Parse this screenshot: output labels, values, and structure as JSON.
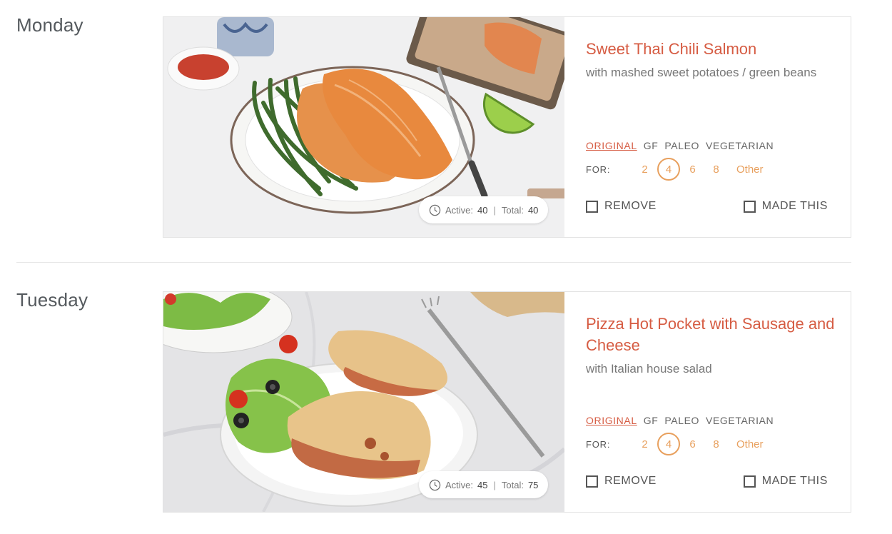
{
  "days": [
    {
      "day": "Monday",
      "recipe": {
        "title": "Sweet Thai Chili Salmon",
        "subtitle": "with mashed sweet potatoes / green beans",
        "tags": [
          "ORIGINAL",
          "GF",
          "PALEO",
          "VEGETARIAN"
        ],
        "for_label": "FOR:",
        "servings": [
          "2",
          "4",
          "6",
          "8"
        ],
        "servings_other": "Other",
        "selected_serving": "4",
        "time": {
          "active_label": "Active:",
          "active": "40",
          "total_label": "Total:",
          "total": "40"
        },
        "remove_label": "REMOVE",
        "made_label": "MADE THIS"
      }
    },
    {
      "day": "Tuesday",
      "recipe": {
        "title": "Pizza Hot Pocket with Sausage and Cheese",
        "subtitle": "with Italian house salad",
        "tags": [
          "ORIGINAL",
          "GF",
          "PALEO",
          "VEGETARIAN"
        ],
        "for_label": "FOR:",
        "servings": [
          "2",
          "4",
          "6",
          "8"
        ],
        "servings_other": "Other",
        "selected_serving": "4",
        "time": {
          "active_label": "Active:",
          "active": "45",
          "total_label": "Total:",
          "total": "75"
        },
        "remove_label": "REMOVE",
        "made_label": "MADE THIS"
      }
    }
  ],
  "colors": {
    "accent": "#d65c43",
    "serving": "#e8a05e",
    "day_text": "#555a5e"
  },
  "icons": {
    "time": "clock-icon",
    "checkbox": "checkbox-empty"
  }
}
